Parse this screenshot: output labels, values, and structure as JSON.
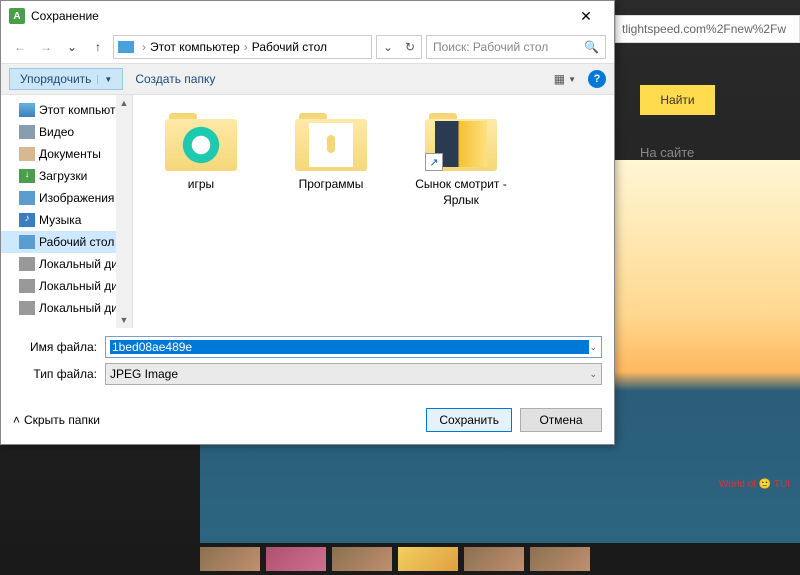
{
  "dialog": {
    "title": "Сохранение",
    "close_glyph": "✕"
  },
  "nav": {
    "back_glyph": "←",
    "fwd_glyph": "→",
    "up_glyph": "↑",
    "crumb_root": "Этот компьютер",
    "crumb_leaf": "Рабочий стол",
    "refresh_glyph": "↻",
    "dropdown_glyph": "⌄"
  },
  "search": {
    "placeholder": "Поиск: Рабочий стол",
    "mag_glyph": "🔍"
  },
  "toolbar": {
    "organize": "Упорядочить",
    "newfolder": "Создать папку",
    "view_glyph": "▦",
    "help_glyph": "?"
  },
  "sidebar": {
    "items": [
      {
        "label": "Этот компьютер",
        "icon": "ico-pc"
      },
      {
        "label": "Видео",
        "icon": "ico-vid"
      },
      {
        "label": "Документы",
        "icon": "ico-doc"
      },
      {
        "label": "Загрузки",
        "icon": "ico-dl"
      },
      {
        "label": "Изображения",
        "icon": "ico-img"
      },
      {
        "label": "Музыка",
        "icon": "ico-mus"
      },
      {
        "label": "Рабочий стол",
        "icon": "ico-desk",
        "selected": true
      },
      {
        "label": "Локальный дис",
        "icon": "ico-disk"
      },
      {
        "label": "Локальный дис",
        "icon": "ico-disk"
      },
      {
        "label": "Локальный дис",
        "icon": "ico-disk"
      }
    ]
  },
  "content": {
    "items": [
      {
        "label": "игры",
        "kind": "folder-1"
      },
      {
        "label": "Программы",
        "kind": "folder-2"
      },
      {
        "label": "Сынок смотрит - Ярлык",
        "kind": "folder-3",
        "shortcut": true
      }
    ]
  },
  "fields": {
    "filename_label": "Имя файла:",
    "filename_value": "1bed08ae489e",
    "filetype_label": "Тип файла:",
    "filetype_value": "JPEG Image"
  },
  "buttons": {
    "hide_folders": "Скрыть папки",
    "save": "Сохранить",
    "cancel": "Отмена"
  },
  "background": {
    "url_fragment": "tlightspeed.com%2Fnew%2Fw",
    "yandex_find": "Найти",
    "tab_label": "На сайте",
    "tui": "World of 🙂 TUI"
  }
}
